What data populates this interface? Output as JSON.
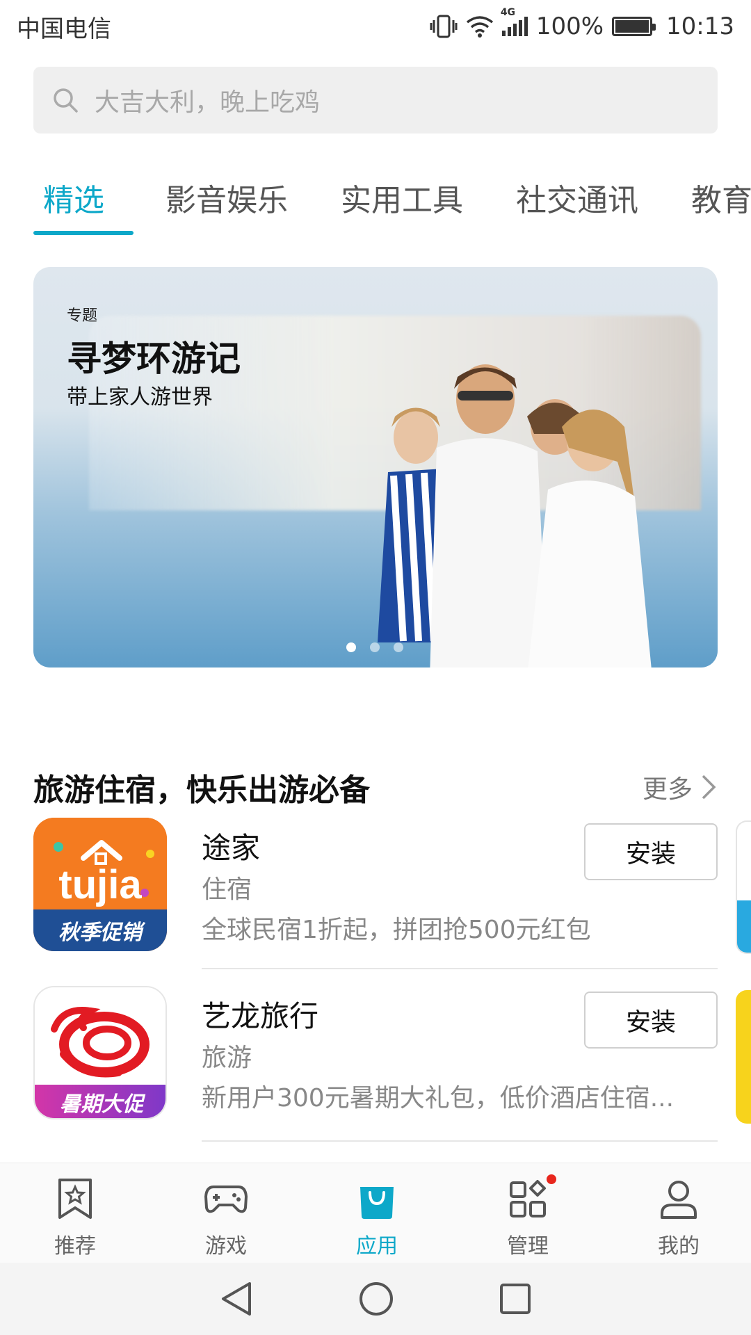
{
  "status_bar": {
    "carrier": "中国电信",
    "network": "4G",
    "battery": "100%",
    "time": "10:13"
  },
  "search": {
    "placeholder": "大吉大利，晚上吃鸡"
  },
  "tabs": [
    {
      "label": "精选",
      "active": true
    },
    {
      "label": "影音娱乐",
      "active": false
    },
    {
      "label": "实用工具",
      "active": false
    },
    {
      "label": "社交通讯",
      "active": false
    },
    {
      "label": "教育",
      "active": false
    }
  ],
  "banner": {
    "label": "专题",
    "title": "寻梦环游记",
    "subtitle": "带上家人游世界",
    "page_count": 3,
    "current_page": 1
  },
  "section": {
    "title": "旅游住宿，快乐出游必备",
    "more": "更多"
  },
  "apps": [
    {
      "name": "途家",
      "category": "住宿",
      "description": "全球民宿1折起，拼团抢500元红包",
      "button": "安装",
      "icon_text": "tujia",
      "icon_badge": "秋季促销",
      "icon_color": "#f47b20"
    },
    {
      "name": "艺龙旅行",
      "category": "旅游",
      "description": "新用户300元暑期大礼包，低价酒店住宿...",
      "button": "安装",
      "icon_badge": "暑期大促",
      "icon_color": "#e21b23"
    }
  ],
  "bottom_nav": [
    {
      "label": "推荐",
      "icon": "star-bookmark-icon",
      "active": false
    },
    {
      "label": "游戏",
      "icon": "gamepad-icon",
      "active": false
    },
    {
      "label": "应用",
      "icon": "shopping-bag-icon",
      "active": true
    },
    {
      "label": "管理",
      "icon": "grid-manage-icon",
      "active": false,
      "badge": true
    },
    {
      "label": "我的",
      "icon": "person-icon",
      "active": false
    }
  ],
  "colors": {
    "accent": "#0da8c9",
    "badge": "#e8261d"
  }
}
